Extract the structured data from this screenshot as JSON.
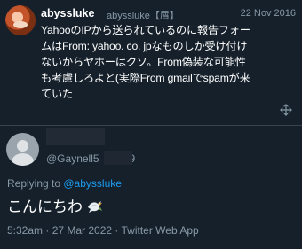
{
  "quoted": {
    "display_name": "abyssluke",
    "handle": "abyssluke【屑】",
    "date": "22 Nov 2016",
    "text_lines": [
      "YahooのIPから送られているのに報告フォー",
      "ムはFrom: yahoo. co. jpなものしか受け付け",
      "ないからヤホーはクソ。From偽装な可能性",
      "も考慮しろよと(実際From gmailでspamが来",
      "ていた"
    ]
  },
  "reply": {
    "handle": "@Gaynell5",
    "handle_tail": "9",
    "reply_prefix": "Replying to ",
    "reply_mention": "@abyssluke",
    "text": "こんにちわ",
    "meta": "5:32am · 27 Mar 2022 · Twitter Web App"
  },
  "colors": {
    "background": "#15202b",
    "secondary_text": "#8899a6",
    "link": "#1d9bf0",
    "divider": "#38444d"
  },
  "icons": {
    "quoted_avatar": "avatar-icon",
    "reply_avatar": "default-avatar-icon",
    "expand": "move-arrows-icon",
    "emoji": "dove-icon"
  }
}
